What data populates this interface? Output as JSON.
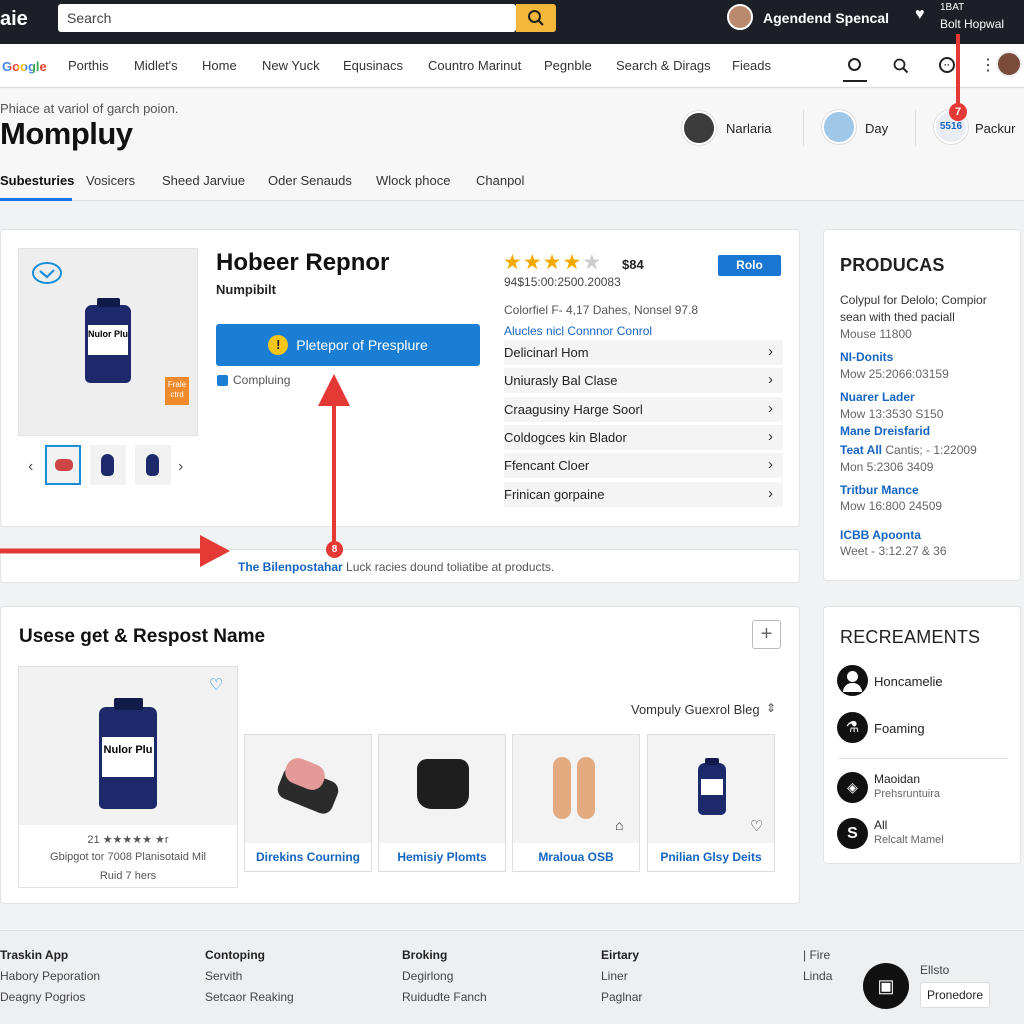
{
  "topbar": {
    "logo": "aie",
    "search_placeholder": "Search",
    "user_name": "Agendend Spencal",
    "account_line1": "1BAT",
    "account_line2": "Bolt Hopwal"
  },
  "nav": {
    "google": "Google",
    "items": [
      "Porthis",
      "Midlet's",
      "Home",
      "New Yuck",
      "Equsinacs",
      "Countro Marinut",
      "Pegnble",
      "Search & Dirags",
      "Fieads"
    ]
  },
  "header": {
    "breadcrumb": "Phiace at variol of garch poion.",
    "site_title": "Mompluy",
    "chips": [
      {
        "label": "Narlaria"
      },
      {
        "label": "Day"
      },
      {
        "label": "Packur",
        "badge": "7",
        "avatar_text": "5516"
      }
    ]
  },
  "tabs": [
    "Subesturies",
    "Vosicers",
    "Sheed Jarviue",
    "Oder Senauds",
    "Wlock phoce",
    "Chanpol"
  ],
  "product": {
    "title": "Hobeer Repnor",
    "subtitle": "Numpibilt",
    "cta_label": "Pletepor of Presplure",
    "checkbox_label": "Compluing",
    "rating_stars": 4,
    "price": "$84",
    "rating_count": "94$15:00:2500.20083",
    "badge": "Rolo",
    "info_line": "Colorfiel F- 4,17 Dahes, Nonsel 97.8",
    "info_link": "Alucles nicl Connnor Conrol",
    "rows": [
      "Delicinarl Hom",
      "Uniurasly Bal Clase",
      "Craagusiny Harge Soorl",
      "Coldogces kin Blador",
      "Ffencant Cloer",
      "Frinican gorpaine"
    ],
    "thumb_label": "Frale ctrd",
    "main_bottle_label": "Nulor Plu"
  },
  "notice": {
    "highlight": "The Bilenpostahar",
    "text": " Luck racies dound toliatibe at products.",
    "marker": "8"
  },
  "products_panel": {
    "title": "PRODUCAS",
    "desc": "Colypul for Delolo; Compior sean with thed paciall",
    "meta": "Mouse 11800",
    "items": [
      {
        "name": "NI-Donits",
        "meta": "Mow 25:2066:03159"
      },
      {
        "name": "Nuarer Lader",
        "meta": "Mow 13:3530 S150"
      },
      {
        "name": "Mane Dreisfarid",
        "meta": ""
      },
      {
        "name": "Teat All",
        "extra": "Cantis; - 1:22009",
        "meta": "Mon 5:2306 3409"
      },
      {
        "name": "Tritbur Mance",
        "meta": "Mow 16:800 24509"
      },
      {
        "name": "ICBB Apoonta",
        "meta": "Weet - 3:12.27 & 36"
      }
    ]
  },
  "usage": {
    "title": "Usese get & Respost Name",
    "sort_label": "Vompuly Guexrol Bleg",
    "featured_rating": "21 ★★★★★ ★r",
    "featured_line1": "Gbipgot tor 7008 Planisotaid Mil",
    "featured_line2": "Ruid 7 hers",
    "featured_label": "Nulor Plu",
    "tiles": [
      "Direkins Courning",
      "Hemisiy Plomts",
      "Mraloua OSB",
      "Pnilian Glsy Deits"
    ]
  },
  "recreaments": {
    "title": "RECREAMENTS",
    "items": [
      {
        "label": "Honcamelie",
        "sub": ""
      },
      {
        "label": "Foaming",
        "sub": ""
      },
      {
        "label": "Maoidan",
        "sub": "Prehsruntuira"
      },
      {
        "label": "All",
        "sub": "Relcalt Mamel"
      }
    ]
  },
  "footer": {
    "cols": [
      {
        "head": "Traskin App",
        "links": [
          "Habory Peporation",
          "Deagny Pogrios"
        ]
      },
      {
        "head": "Contoping",
        "links": [
          "Servith",
          "Setcaor Reaking"
        ]
      },
      {
        "head": "Broking",
        "links": [
          "Degirlong",
          "Ruidudte Fanch"
        ]
      },
      {
        "head": "Eirtary",
        "links": [
          "Liner",
          "Paglnar"
        ]
      },
      {
        "head": "| Fire",
        "links": [
          "Linda"
        ]
      }
    ],
    "chat_label": "Ellsto",
    "chat_button": "Pronedore"
  },
  "colors": {
    "accent": "#1a73e8",
    "cta": "#1a7fd4",
    "search_btn": "#f4b73a",
    "arrow": "#e53935",
    "badge": "#1976d2"
  }
}
